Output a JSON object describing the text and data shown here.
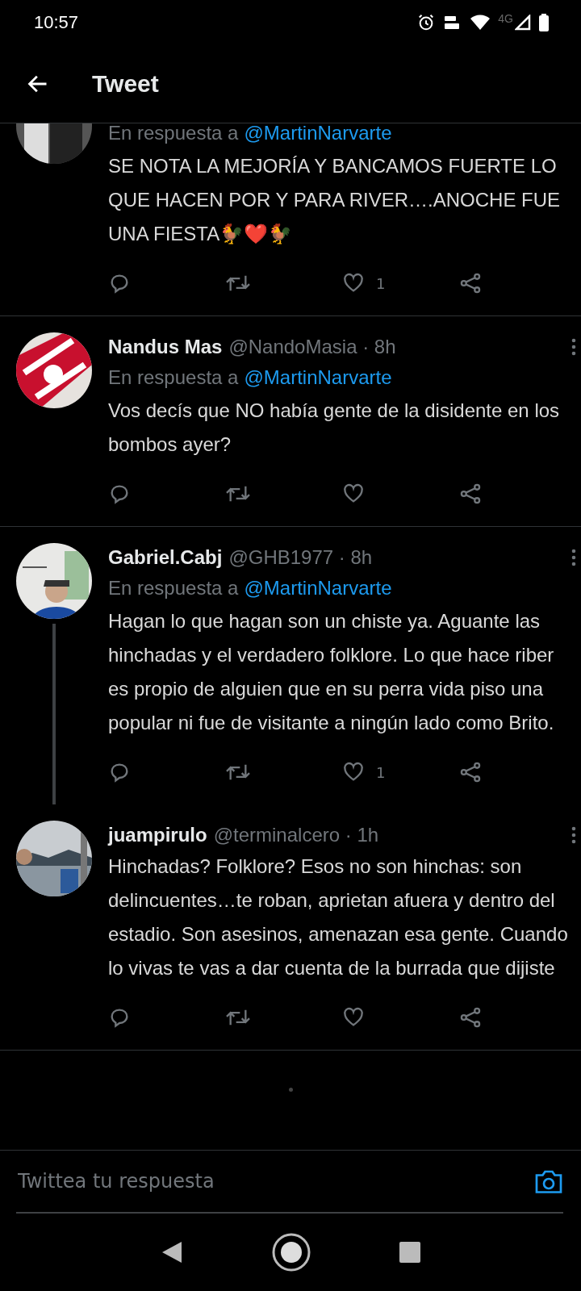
{
  "status_bar": {
    "time": "10:57",
    "network": "4G"
  },
  "header": {
    "title": "Tweet"
  },
  "tweets": [
    {
      "reply_to_label": "En respuesta a",
      "reply_to": "@MartinNarvarte",
      "text": "SE NOTA LA MEJORÍA Y BANCAMOS FUERTE LO QUE HACEN POR Y PARA RIVER….ANOCHE FUE UNA FIESTA🐓❤️🐓",
      "likes": "1",
      "thread": false,
      "cut_top": true
    },
    {
      "name": "Nandus Mas",
      "meta": "@NandoMasia · 8h",
      "reply_to_label": "En respuesta a",
      "reply_to": "@MartinNarvarte",
      "text": "Vos decís que NO había gente de la disidente en los bombos ayer?",
      "thread": false,
      "cut_top": false
    },
    {
      "name": "Gabriel.Cabj",
      "meta": "@GHB1977 · 8h",
      "reply_to_label": "En respuesta a",
      "reply_to": "@MartinNarvarte",
      "text": "Hagan lo que hagan son un chiste ya. Aguante las hinchadas y el verdadero folklore. Lo que hace riber es propio de alguien que en su perra vida piso una popular ni fue de visitante a ningún lado como Brito.",
      "likes": "1",
      "thread": true,
      "cut_top": false
    },
    {
      "name": "juampirulo",
      "meta": "@terminalcero · 1h",
      "text": "Hinchadas? Folklore? Esos no son hinchas: son delincuentes…te roban, aprietan afuera y dentro del estadio. Son asesinos, amenazan esa gente. Cuando lo vivas te vas a dar cuenta de la burrada que dijiste",
      "thread": false,
      "cut_top": false
    }
  ],
  "reply_bar": {
    "placeholder": "Twittea tu respuesta"
  }
}
